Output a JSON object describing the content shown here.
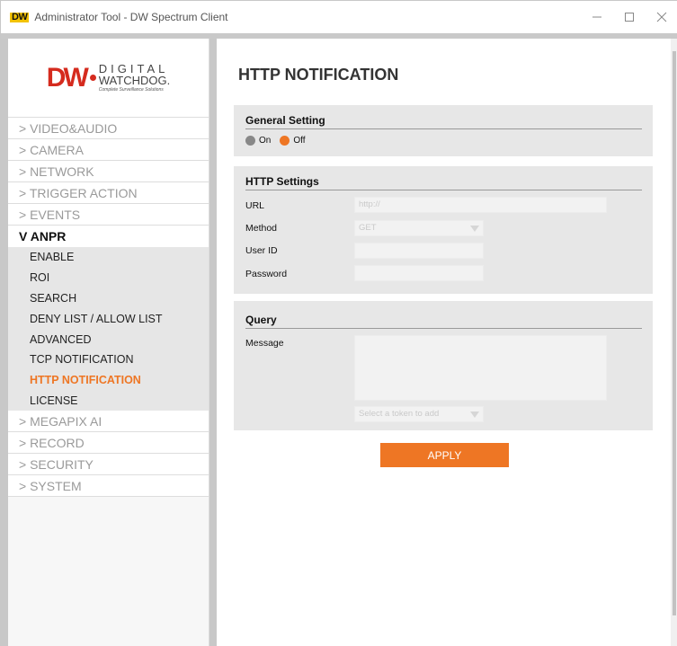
{
  "window": {
    "title": "Administrator Tool - DW Spectrum Client",
    "app_logo": "DW",
    "minimize_icon": "minimize-icon",
    "maximize_icon": "maximize-icon",
    "close_icon": "close-icon"
  },
  "brand": {
    "mark": "DW",
    "line1": "DIGITAL",
    "line2": "WATCHDOG.",
    "tagline": "Complete Surveillance Solutions",
    "color": "#d52b1e"
  },
  "sidebar": {
    "items_top": [
      {
        "label": "> VIDEO&AUDIO"
      },
      {
        "label": "> CAMERA"
      },
      {
        "label": "> NETWORK"
      },
      {
        "label": "> TRIGGER ACTION"
      },
      {
        "label": "> EVENTS"
      }
    ],
    "active": {
      "label": "V ANPR"
    },
    "sub_items": [
      {
        "label": "ENABLE"
      },
      {
        "label": "ROI"
      },
      {
        "label": "SEARCH"
      },
      {
        "label": "DENY LIST / ALLOW LIST"
      },
      {
        "label": "ADVANCED"
      },
      {
        "label": "TCP NOTIFICATION"
      },
      {
        "label": "HTTP NOTIFICATION",
        "current": true
      },
      {
        "label": "LICENSE"
      }
    ],
    "items_bottom": [
      {
        "label": "> MEGAPIX AI"
      },
      {
        "label": "> RECORD"
      },
      {
        "label": "> SECURITY"
      },
      {
        "label": "> SYSTEM"
      }
    ]
  },
  "main": {
    "title": "HTTP NOTIFICATION",
    "general": {
      "heading": "General Setting",
      "on_label": "On",
      "off_label": "Off",
      "selected": "Off"
    },
    "http": {
      "heading": "HTTP Settings",
      "url_label": "URL",
      "url_placeholder": "http://",
      "method_label": "Method",
      "method_value": "GET",
      "userid_label": "User ID",
      "userid_value": "",
      "password_label": "Password",
      "password_value": ""
    },
    "query": {
      "heading": "Query",
      "message_label": "Message",
      "message_value": "",
      "token_select": "Select a token to add"
    },
    "apply_label": "APPLY"
  },
  "colors": {
    "accent": "#ee7624",
    "panel": "#e7e7e7",
    "sub_nav": "#e6e6e6"
  }
}
